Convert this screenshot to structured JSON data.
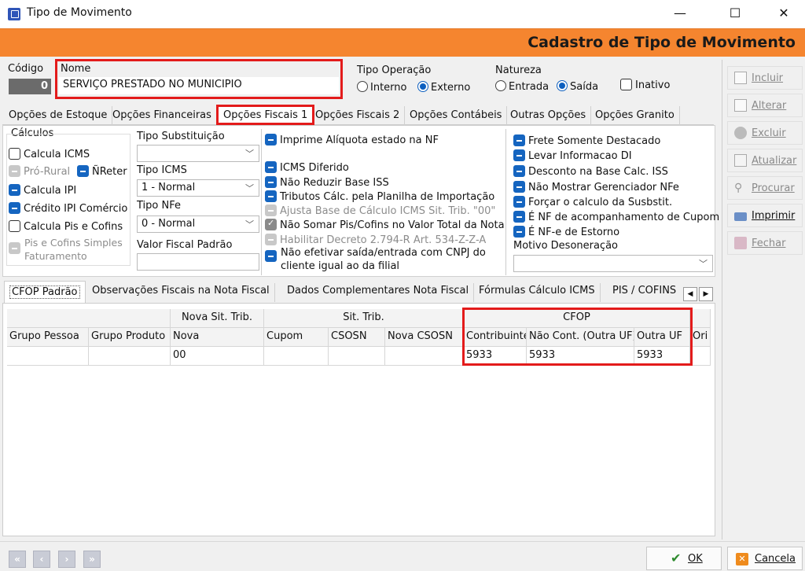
{
  "window": {
    "title": "Tipo de Movimento",
    "minimize": "—",
    "maximize": "☐",
    "close": "✕"
  },
  "banner": {
    "title": "Cadastro de Tipo de Movimento"
  },
  "header": {
    "codigo_label": "Código",
    "codigo_value": "0",
    "nome_label": "Nome",
    "nome_value": "SERVIÇO PRESTADO NO MUNICIPIO",
    "tipo_operacao_label": "Tipo Operação",
    "interno_label": "Interno",
    "externo_label": "Externo",
    "natureza_label": "Natureza",
    "entrada_label": "Entrada",
    "saida_label": "Saída",
    "inativo_label": "Inativo"
  },
  "tabs": [
    "Opções de Estoque",
    "Opções Financeiras",
    "Opções Fiscais 1",
    "Opções Fiscais 2",
    "Opções Contábeis",
    "Outras Opções",
    "Opções Granito"
  ],
  "calculos": {
    "title": "Cálculos",
    "calcula_icms": "Calcula ICMS",
    "pro_rural": "Pró-Rural",
    "nreter": "ÑReter",
    "calcula_ipi": "Calcula IPI",
    "credito_ipi": "Crédito IPI Comércio",
    "calcula_pis": "Calcula Pis e Cofins",
    "pis_simples_1": "Pis e Cofins Simples",
    "pis_simples_2": "Faturamento"
  },
  "fields": {
    "tipo_substituicao_label": "Tipo Substituição",
    "tipo_substituicao_value": "",
    "tipo_icms_label": "Tipo ICMS",
    "tipo_icms_value": "1 - Normal",
    "tipo_nfe_label": "Tipo NFe",
    "tipo_nfe_value": "0 - Normal",
    "valor_fiscal_label": "Valor Fiscal Padrão",
    "valor_fiscal_value": ""
  },
  "options_mid": [
    "Imprime Alíquota estado na NF",
    "ICMS Diferido",
    "Não Reduzir Base ISS",
    "Tributos Cálc. pela Planilha de Importação",
    "Ajusta Base de Cálculo ICMS Sit. Trib. \"00\"",
    "Não Somar Pis/Cofins no Valor Total da Nota",
    "Habilitar Decreto 2.794-R Art. 534-Z-Z-A",
    "Não efetivar saída/entrada com CNPJ do",
    "cliente igual ao da filial"
  ],
  "options_right": [
    "Frete Somente Destacado",
    "Levar Informacao DI",
    "Desconto na Base Calc. ISS",
    "Não Mostrar Gerenciador NFe",
    "Forçar o calculo da Susbstit.",
    "É NF de acompanhamento de Cupom",
    "É NF-e de Estorno"
  ],
  "motivo_label": "Motivo Desoneração",
  "motivo_value": "",
  "subtabs": [
    "CFOP Padrão",
    "Observações Fiscais na Nota Fiscal",
    "Dados Complementares Nota Fiscal",
    "Fórmulas Cálculo ICMS",
    "PIS / COFINS"
  ],
  "grid": {
    "group_headers": [
      "Nova Sit. Trib.",
      "Sit. Trib.",
      "CFOP"
    ],
    "columns": [
      "Grupo Pessoa",
      "Grupo Produto",
      "Nova",
      "Cupom",
      "CSOSN",
      "Nova CSOSN",
      "Contribuinte",
      "Não Cont. (Outra UF)",
      "Outra UF",
      "Ori"
    ],
    "rows": [
      [
        "",
        "",
        "00",
        "",
        "",
        "",
        "5933",
        "5933",
        "5933",
        ""
      ]
    ]
  },
  "side_buttons": [
    "Incluir",
    "Alterar",
    "Excluir",
    "Atualizar",
    "Procurar",
    "Imprimir",
    "Fechar"
  ],
  "footer": {
    "ok": "OK",
    "cancel": "Cancela"
  },
  "colors": {
    "banner": "#f5852f",
    "highlight": "#e31b1b",
    "check_blue": "#1565c0"
  }
}
